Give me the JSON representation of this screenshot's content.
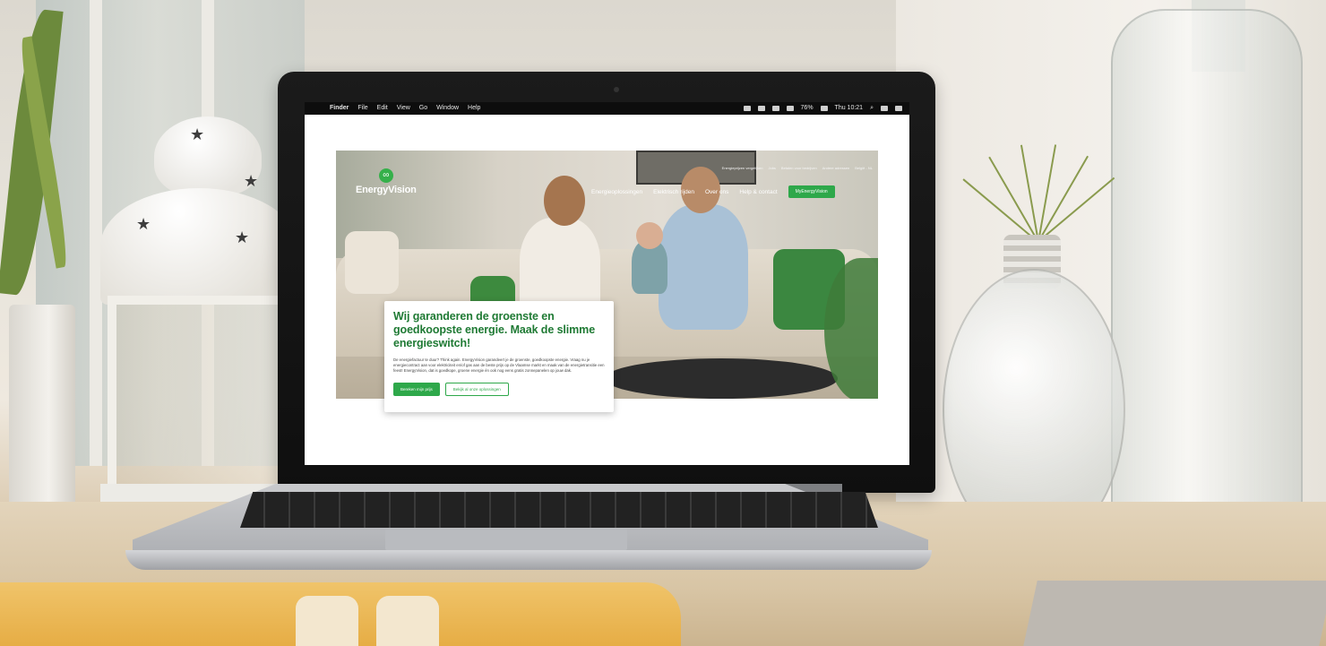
{
  "menubar": {
    "items": [
      "Finder",
      "File",
      "Edit",
      "View",
      "Go",
      "Window",
      "Help"
    ],
    "battery": "76%",
    "clock": "Thu 10:21"
  },
  "site": {
    "brand": "EnergyVision",
    "top_nav": [
      "Energieprijzen vergelijken",
      "Jobs",
      "Betalen voor bedrijven",
      "Andere adressen",
      "België - NL"
    ],
    "main_nav": [
      "Energieoplossingen",
      "Elektrisch rijden",
      "Over ons",
      "Help & contact"
    ],
    "nav_cta": "MyEnergyVision",
    "hero": {
      "headline": "Wij garanderen de groenste en goedkoopste energie. Maak de slimme energieswitch!",
      "body": "De energiefactuur te duur? Think again. EnergyVision garandeert je de groenste, goedkoopste energie. Vraag nu je energiecontract aan voor elektriciteit en/of gas aan de beste prijs op de Vlaamse markt en maak van de energietransitie een feest! EnergyVision, dat is goedkope, groene energie én ook nog eens gratis zonnepanelen op jouw dak.",
      "primary_button": "Bereken mijn prijs",
      "secondary_button": "Bekijk al onze oplossingen"
    }
  },
  "colors": {
    "brand_green": "#2ea84a",
    "headline_green": "#1f7a34"
  }
}
